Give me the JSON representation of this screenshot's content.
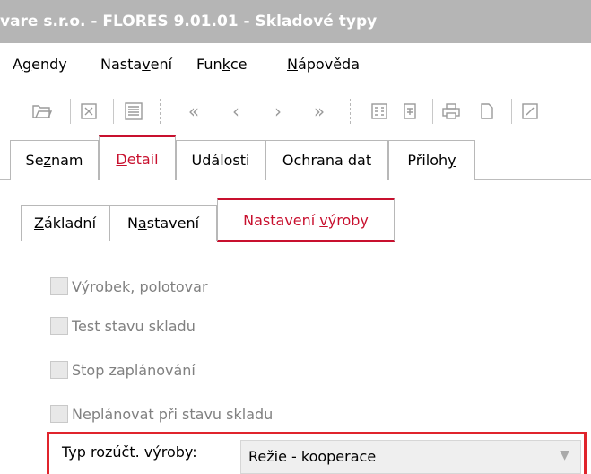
{
  "window": {
    "title": "vare  s.r.o. - FLORES 9.01.01 - Skladové typy"
  },
  "menu": {
    "items": [
      {
        "pre": "A",
        "ul": "g",
        "post": "endy"
      },
      {
        "pre": "Nasta",
        "ul": "v",
        "post": "ení"
      },
      {
        "pre": "Fun",
        "ul": "k",
        "post": "ce"
      },
      {
        "pre": "",
        "ul": "N",
        "post": "ápověda"
      }
    ]
  },
  "toolbar": {
    "icons": [
      "open-folder-icon",
      "delete-icon",
      "list-icon",
      "first-icon",
      "previous-icon",
      "next-icon",
      "last-icon",
      "form-icon",
      "form-small-icon",
      "print-icon",
      "new-document-icon",
      "export-icon"
    ],
    "glyphs": {
      "first": "«",
      "previous": "‹",
      "next": "›",
      "last": "»"
    }
  },
  "tabs_main": [
    {
      "pre": "Se",
      "ul": "z",
      "post": "nam",
      "active": false
    },
    {
      "pre": "",
      "ul": "D",
      "post": "etail",
      "active": true
    },
    {
      "pre": "Události",
      "ul": "",
      "post": "",
      "active": false
    },
    {
      "pre": "Ochrana dat",
      "ul": "",
      "post": "",
      "active": false
    },
    {
      "pre": "Přiloh",
      "ul": "y",
      "post": "",
      "active": false
    }
  ],
  "tabs_sub": [
    {
      "pre": "",
      "ul": "Z",
      "post": "ákladní",
      "active": false
    },
    {
      "pre": "N",
      "ul": "a",
      "post": "stavení",
      "active": false
    },
    {
      "pre": "Nastavení ",
      "ul": "v",
      "post": "ýroby",
      "active": true
    }
  ],
  "checkboxes": [
    {
      "label": "Výrobek, polotovar",
      "checked": false
    },
    {
      "label": "Test stavu skladu",
      "checked": false
    },
    {
      "label": "Stop zaplánování",
      "checked": false
    },
    {
      "label": "Neplánovat při stavu skladu",
      "checked": false
    }
  ],
  "typ": {
    "label": "Typ rozúčt. výroby:",
    "value": "Režie - kooperace"
  },
  "colors": {
    "accent": "#c8102e",
    "highlight": "#e0242c",
    "titlebar": "#b5b5b5"
  }
}
